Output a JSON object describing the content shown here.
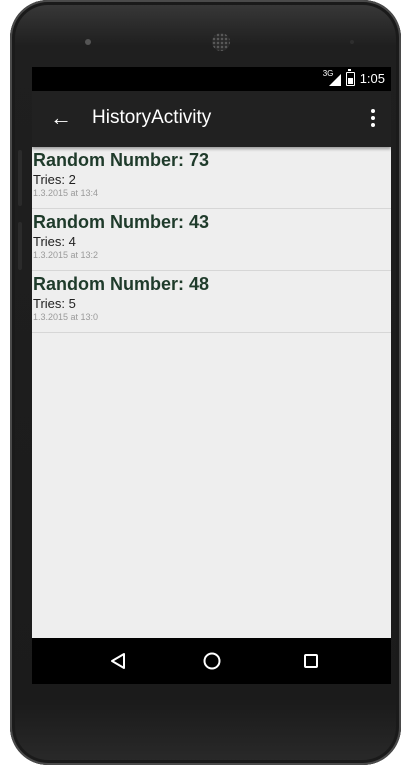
{
  "status_bar": {
    "signal_label": "3G",
    "time": "1:05"
  },
  "app_bar": {
    "back_icon": "arrow-left-icon",
    "title": "HistoryActivity",
    "menu_icon": "overflow-menu-icon"
  },
  "history": [
    {
      "number_text": "Random Number: 73",
      "tries_text": "Tries: 2",
      "date_text": "1.3.2015 at 13:4"
    },
    {
      "number_text": "Random Number: 43",
      "tries_text": "Tries: 4",
      "date_text": "1.3.2015 at 13:2"
    },
    {
      "number_text": "Random Number: 48",
      "tries_text": "Tries: 5",
      "date_text": "1.3.2015 at 13:0"
    }
  ],
  "nav_bar": {
    "back": "triangle-back-icon",
    "home": "circle-home-icon",
    "recents": "square-recents-icon"
  },
  "colors": {
    "app_bar": "#212121",
    "list_bg": "#eeeeee",
    "number_text": "#1f3b2b"
  }
}
